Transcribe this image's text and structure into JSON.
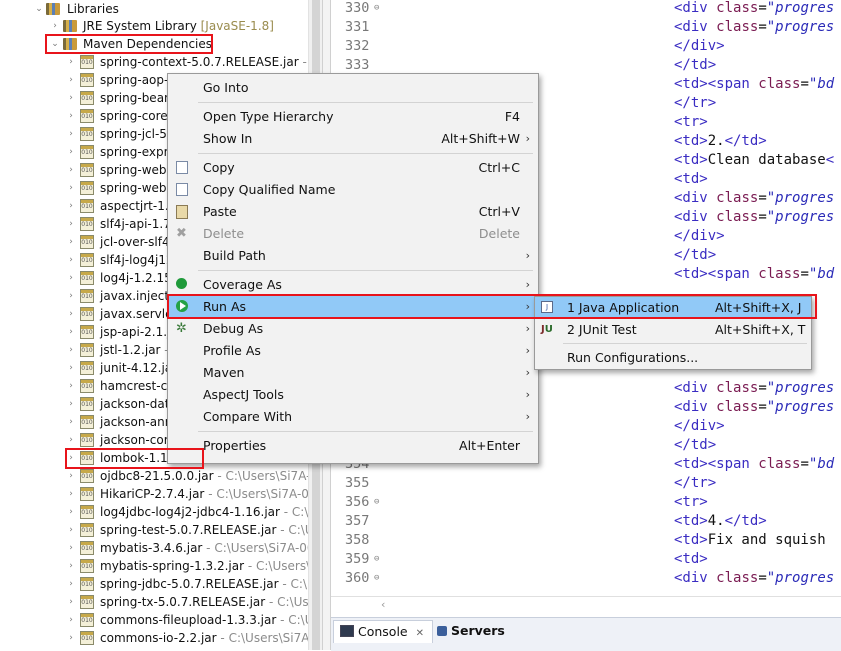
{
  "tree": {
    "libraries_label": "Libraries",
    "jre": {
      "label": "JRE System Library",
      "decoration": "[JavaSE-1.8]"
    },
    "maven": {
      "label": "Maven Dependencies"
    },
    "jars": [
      {
        "name": "spring-context-5.0.7.RELEASE.jar",
        "path": " - C:\\"
      },
      {
        "name": "spring-aop-5",
        "path": ""
      },
      {
        "name": "spring-beans",
        "path": ""
      },
      {
        "name": "spring-core-5",
        "path": ""
      },
      {
        "name": "spring-jcl-5.0",
        "path": ""
      },
      {
        "name": "spring-expre",
        "path": ""
      },
      {
        "name": "spring-webm",
        "path": ""
      },
      {
        "name": "spring-web-5",
        "path": ""
      },
      {
        "name": "aspectjrt-1.9.",
        "path": ""
      },
      {
        "name": "slf4j-api-1.7.",
        "path": ""
      },
      {
        "name": "jcl-over-slf4j",
        "path": ""
      },
      {
        "name": "slf4j-log4j12",
        "path": ""
      },
      {
        "name": "log4j-1.2.15.",
        "path": ""
      },
      {
        "name": "javax.inject-1",
        "path": ""
      },
      {
        "name": "javax.servlet-",
        "path": ""
      },
      {
        "name": "jsp-api-2.1.ja",
        "path": ""
      },
      {
        "name": "jstl-1.2.jar",
        "path": " - ("
      },
      {
        "name": "junit-4.12.jar",
        "path": ""
      },
      {
        "name": "hamcrest-co",
        "path": ""
      },
      {
        "name": "jackson-data",
        "path": ""
      },
      {
        "name": "jackson-ann",
        "path": ""
      },
      {
        "name": "jackson-core",
        "path": ""
      },
      {
        "name": "lombok-1.18.",
        "path": " - C:\\Users\\Si7A"
      },
      {
        "name": "ojdbc8-21.5.0.0.jar",
        "path": " - C:\\Users\\Si7A-0"
      },
      {
        "name": "HikariCP-2.7.4.jar",
        "path": " - C:\\Users\\Si7A-00"
      },
      {
        "name": "log4jdbc-log4j2-jdbc4-1.16.jar",
        "path": " - C:\\U"
      },
      {
        "name": "spring-test-5.0.7.RELEASE.jar",
        "path": " - C:\\Us"
      },
      {
        "name": "mybatis-3.4.6.jar",
        "path": " - C:\\Users\\Si7A-00"
      },
      {
        "name": "mybatis-spring-1.3.2.jar",
        "path": " - C:\\Users\\S"
      },
      {
        "name": "spring-jdbc-5.0.7.RELEASE.jar",
        "path": " - C:\\Us"
      },
      {
        "name": "spring-tx-5.0.7.RELEASE.jar",
        "path": " - C:\\Users"
      },
      {
        "name": "commons-fileupload-1.3.3.jar",
        "path": " - C:\\Us"
      },
      {
        "name": "commons-io-2.2.jar",
        "path": " - C:\\Users\\Si7A-0"
      }
    ]
  },
  "editor": {
    "lines": [
      {
        "num": "330",
        "fold": "⊖",
        "code": [
          [
            "tag",
            "<div "
          ],
          [
            "attr",
            "class"
          ],
          [
            "txt",
            "="
          ],
          [
            "str",
            "\"progres"
          ]
        ]
      },
      {
        "num": "331",
        "fold": "",
        "code": [
          [
            "tag",
            "<div "
          ],
          [
            "attr",
            "class"
          ],
          [
            "txt",
            "="
          ],
          [
            "str",
            "\"progres"
          ]
        ]
      },
      {
        "num": "332",
        "fold": "",
        "code": [
          [
            "tag",
            "</div>"
          ]
        ]
      },
      {
        "num": "333",
        "fold": "",
        "code": [
          [
            "tag",
            "</td>"
          ]
        ]
      },
      {
        "num": "",
        "fold": "",
        "code": [
          [
            "tag",
            "<td><span "
          ],
          [
            "attr",
            "class"
          ],
          [
            "txt",
            "="
          ],
          [
            "str",
            "\"bd"
          ]
        ]
      },
      {
        "num": "",
        "fold": "",
        "code": [
          [
            "tag",
            "</tr>"
          ]
        ]
      },
      {
        "num": "",
        "fold": "",
        "code": [
          [
            "tag",
            "<tr>"
          ]
        ]
      },
      {
        "num": "",
        "fold": "",
        "code": [
          [
            "tag",
            "<td>"
          ],
          [
            "txt",
            "2."
          ],
          [
            "tag",
            "</td>"
          ]
        ]
      },
      {
        "num": "",
        "fold": "",
        "code": [
          [
            "tag",
            "<td>"
          ],
          [
            "txt",
            "Clean database"
          ],
          [
            "tag",
            "<"
          ]
        ]
      },
      {
        "num": "",
        "fold": "",
        "code": [
          [
            "tag",
            "<td>"
          ]
        ]
      },
      {
        "num": "",
        "fold": "",
        "code": [
          [
            "tag",
            "<div "
          ],
          [
            "attr",
            "class"
          ],
          [
            "txt",
            "="
          ],
          [
            "str",
            "\"progres"
          ]
        ]
      },
      {
        "num": "",
        "fold": "",
        "code": [
          [
            "tag",
            "<div "
          ],
          [
            "attr",
            "class"
          ],
          [
            "txt",
            "="
          ],
          [
            "str",
            "\"progres"
          ]
        ]
      },
      {
        "num": "",
        "fold": "",
        "code": [
          [
            "tag",
            "</div>"
          ]
        ]
      },
      {
        "num": "",
        "fold": "",
        "code": [
          [
            "tag",
            "</td>"
          ]
        ]
      },
      {
        "num": "",
        "fold": "",
        "code": [
          [
            "tag",
            "<td><span "
          ],
          [
            "attr",
            "class"
          ],
          [
            "txt",
            "="
          ],
          [
            "str",
            "\"bd"
          ]
        ]
      },
      {
        "num": "",
        "fold": "",
        "code": []
      },
      {
        "num": "",
        "fold": "",
        "code": []
      },
      {
        "num": "",
        "fold": "",
        "code": []
      },
      {
        "num": "",
        "fold": "",
        "code": [
          [
            "txt",
            "nnir"
          ]
        ]
      },
      {
        "num": "",
        "fold": "",
        "code": []
      },
      {
        "num": "",
        "fold": "",
        "code": [
          [
            "tag",
            "<div "
          ],
          [
            "attr",
            "class"
          ],
          [
            "txt",
            "="
          ],
          [
            "str",
            "\"progres"
          ]
        ]
      },
      {
        "num": "",
        "fold": "",
        "code": [
          [
            "tag",
            "<div "
          ],
          [
            "attr",
            "class"
          ],
          [
            "txt",
            "="
          ],
          [
            "str",
            "\"progres"
          ]
        ]
      },
      {
        "num": "",
        "fold": "",
        "code": [
          [
            "tag",
            "</div>"
          ]
        ]
      },
      {
        "num": "",
        "fold": "",
        "code": [
          [
            "tag",
            "</td>"
          ]
        ]
      },
      {
        "num": "354",
        "fold": "",
        "code": [
          [
            "tag",
            "<td><span "
          ],
          [
            "attr",
            "class"
          ],
          [
            "txt",
            "="
          ],
          [
            "str",
            "\"bd"
          ]
        ]
      },
      {
        "num": "355",
        "fold": "",
        "code": [
          [
            "tag",
            "</tr>"
          ]
        ]
      },
      {
        "num": "356",
        "fold": "⊖",
        "code": [
          [
            "tag",
            "<tr>"
          ]
        ]
      },
      {
        "num": "357",
        "fold": "",
        "code": [
          [
            "tag",
            "<td>"
          ],
          [
            "txt",
            "4."
          ],
          [
            "tag",
            "</td>"
          ]
        ]
      },
      {
        "num": "358",
        "fold": "",
        "code": [
          [
            "tag",
            "<td>"
          ],
          [
            "txt",
            "Fix and squish"
          ]
        ]
      },
      {
        "num": "359",
        "fold": "⊖",
        "code": [
          [
            "tag",
            "<td>"
          ]
        ]
      },
      {
        "num": "360",
        "fold": "⊖",
        "code": [
          [
            "tag",
            "<div "
          ],
          [
            "attr",
            "class"
          ],
          [
            "txt",
            "="
          ],
          [
            "str",
            "\"progres"
          ]
        ]
      }
    ]
  },
  "bottom_tabs": {
    "console": "Console",
    "console_close": "✕",
    "servers": "Servers"
  },
  "context_menu": {
    "go_into": "Go Into",
    "open_type_hierarchy": {
      "label": "Open Type Hierarchy",
      "shortcut": "F4"
    },
    "show_in": {
      "label": "Show In",
      "shortcut": "Alt+Shift+W"
    },
    "copy": {
      "label": "Copy",
      "shortcut": "Ctrl+C"
    },
    "copy_qualified_name": "Copy Qualified Name",
    "paste": {
      "label": "Paste",
      "shortcut": "Ctrl+V"
    },
    "delete": {
      "label": "Delete",
      "shortcut": "Delete"
    },
    "build_path": "Build Path",
    "coverage_as": "Coverage As",
    "run_as": "Run As",
    "debug_as": "Debug As",
    "profile_as": "Profile As",
    "maven": "Maven",
    "aspectj_tools": "AspectJ Tools",
    "compare_with": "Compare With",
    "properties": {
      "label": "Properties",
      "shortcut": "Alt+Enter"
    }
  },
  "submenu": {
    "java_application": {
      "label": "1 Java Application",
      "shortcut": "Alt+Shift+X, J"
    },
    "junit_test": {
      "label": "2 JUnit Test",
      "shortcut": "Alt+Shift+X, T"
    },
    "run_configurations": "Run Configurations..."
  },
  "colors": {
    "highlight": "#91c9f7",
    "annotation_red": "#e8141b",
    "tag": "#3a2cc2",
    "attr": "#7a1b52"
  }
}
